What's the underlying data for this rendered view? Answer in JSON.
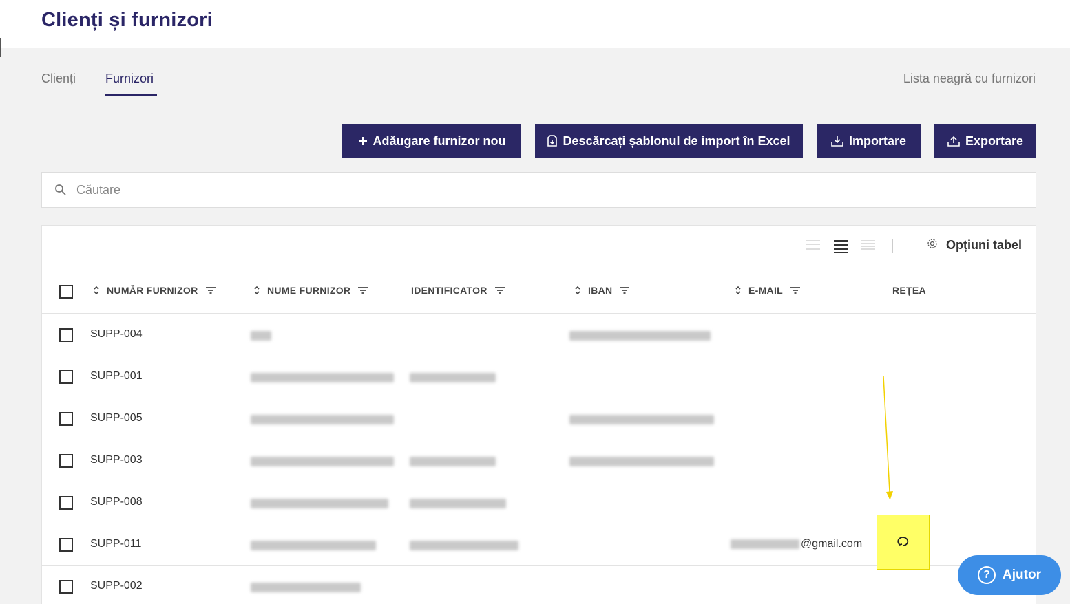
{
  "page": {
    "title": "Clienți și furnizori"
  },
  "tabs": [
    {
      "label": "Clienți",
      "active": false
    },
    {
      "label": "Furnizori",
      "active": true
    }
  ],
  "blacklist_link": "Lista neagră cu furnizori",
  "actions": {
    "add_supplier": "Adăugare furnizor nou",
    "download_template": "Descărcați șablonul de import în Excel",
    "import": "Importare",
    "export": "Exportare"
  },
  "search": {
    "placeholder": "Căutare",
    "value": ""
  },
  "table": {
    "options_label": "Opțiuni tabel",
    "columns": {
      "number": "NUMĂR FURNIZOR",
      "name": "NUME FURNIZOR",
      "identifier": "IDENTIFICATOR",
      "iban": "IBAN",
      "email": "E-MAIL",
      "network": "REȚEA"
    },
    "rows": [
      {
        "number": "SUPP-004",
        "email": ""
      },
      {
        "number": "SUPP-001",
        "email": ""
      },
      {
        "number": "SUPP-005",
        "email": ""
      },
      {
        "number": "SUPP-003",
        "email": ""
      },
      {
        "number": "SUPP-008",
        "email": ""
      },
      {
        "number": "SUPP-011",
        "email": "@gmail.com"
      },
      {
        "number": "SUPP-002",
        "email": ""
      }
    ]
  },
  "help": {
    "label": "Ajutor"
  },
  "colors": {
    "primary": "#2b2765",
    "accent_blue": "#3d8ee6",
    "highlight": "#ffff66"
  },
  "icons": [
    "plus-icon",
    "template-file-icon",
    "download-icon",
    "upload-icon",
    "search-icon",
    "gear-icon",
    "sort-icon",
    "filter-icon",
    "network-sync-icon",
    "help-icon"
  ]
}
